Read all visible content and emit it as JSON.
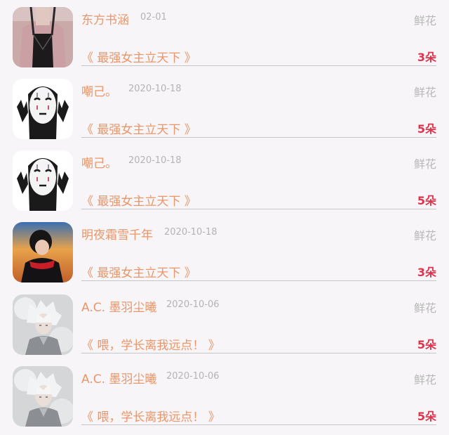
{
  "items": [
    {
      "name": "东方书涵",
      "date": "02-01",
      "gift": "鲜花",
      "book": "《 最强女主立天下 》",
      "count": "3朵",
      "avatar_icon": "girl-photo"
    },
    {
      "name": "嘲己。",
      "date": "2020-10-18",
      "gift": "鲜花",
      "book": "《 最强女主立天下 》",
      "count": "5朵",
      "avatar_icon": "no-face-sticker"
    },
    {
      "name": "嘲己。",
      "date": "2020-10-18",
      "gift": "鲜花",
      "book": "《 最强女主立天下 》",
      "count": "5朵",
      "avatar_icon": "no-face-sticker"
    },
    {
      "name": "明夜霜雪千年",
      "date": "2020-10-18",
      "gift": "鲜花",
      "book": "《 最强女主立天下 》",
      "count": "3朵",
      "avatar_icon": "sunset-boy"
    },
    {
      "name": "A.C. 墨羽尘曦",
      "date": "2020-10-06",
      "gift": "鲜花",
      "book": "《 喂，学长离我远点！ 》",
      "count": "5朵",
      "avatar_icon": "anime-boy"
    },
    {
      "name": "A.C. 墨羽尘曦",
      "date": "2020-10-06",
      "gift": "鲜花",
      "book": "《 喂，学长离我远点！ 》",
      "count": "5朵",
      "avatar_icon": "anime-boy"
    }
  ],
  "colors": {
    "accent": "#e8966a",
    "count": "#e0324b",
    "muted": "#b4b4b4",
    "background": "#f7f5f7"
  }
}
